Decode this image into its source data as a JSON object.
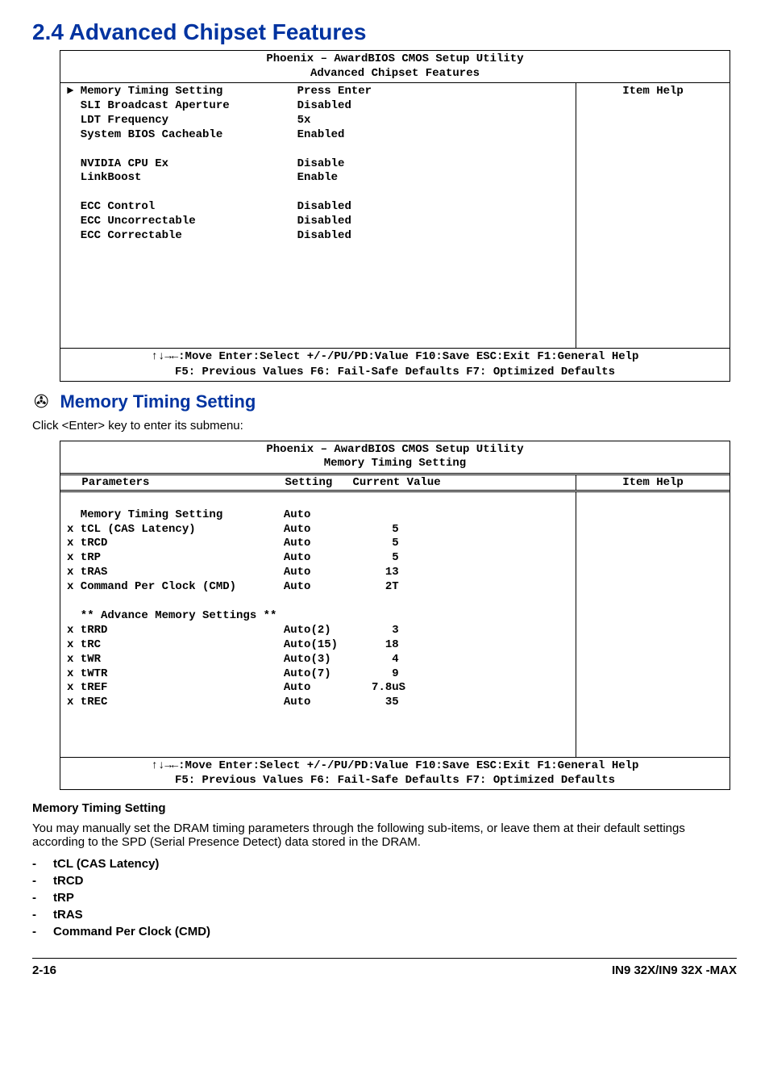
{
  "title": "2.4 Advanced Chipset Features",
  "bios1": {
    "utility": "Phoenix – AwardBIOS CMOS Setup Utility",
    "screen": "Advanced Chipset Features",
    "body": "► Memory Timing Setting           Press Enter\n  SLI Broadcast Aperture          Disabled\n  LDT Frequency                   5x\n  System BIOS Cacheable           Enabled\n\n  NVIDIA CPU Ex                   Disable\n  LinkBoost                       Enable\n\n  ECC Control                     Disabled\n  ECC Uncorrectable               Disabled\n  ECC Correctable                 Disabled\n\n\n\n\n\n\n\n",
    "help_label": "Item Help",
    "footer1": "↑↓→←:Move  Enter:Select  +/-/PU/PD:Value  F10:Save  ESC:Exit  F1:General Help",
    "footer2": "F5: Previous Values   F6: Fail-Safe Defaults   F7: Optimized Defaults"
  },
  "subhead": {
    "icon": "✇",
    "text": "Memory Timing Setting"
  },
  "enter_note": "Click <Enter> key to enter its submenu:",
  "bios2": {
    "utility": "Phoenix – AwardBIOS CMOS Setup Utility",
    "screen": "Memory Timing Setting",
    "th": " Parameters                    Setting   Current Value",
    "help_label": "Item Help",
    "body": "\n  Memory Timing Setting         Auto\nx tCL (CAS Latency)             Auto            5\nx tRCD                          Auto            5\nx tRP                           Auto            5\nx tRAS                          Auto           13\nx Command Per Clock (CMD)       Auto           2T\n\n  ** Advance Memory Settings **\nx tRRD                          Auto(2)         3\nx tRC                           Auto(15)       18\nx tWR                           Auto(3)         4\nx tWTR                          Auto(7)         9\nx tREF                          Auto         7.8uS\nx tREC                          Auto           35\n\n\n\n",
    "footer1": "↑↓→←:Move  Enter:Select  +/-/PU/PD:Value  F10:Save  ESC:Exit  F1:General Help",
    "footer2": "F5: Previous Values   F6: Fail-Safe Defaults   F7: Optimized Defaults"
  },
  "mts_head": "Memory Timing Setting",
  "mts_text": "You may manually set the DRAM timing parameters through the following sub-items, or leave them at their default settings according to the SPD (Serial Presence Detect) data stored in the DRAM.",
  "items": [
    "tCL (CAS Latency)",
    "tRCD",
    "tRP",
    "tRAS",
    "Command Per Clock (CMD)"
  ],
  "footer": {
    "page": "2-16",
    "product": "IN9 32X/IN9 32X -MAX"
  },
  "chart_data": {
    "type": "table",
    "title": "Advanced Chipset Features",
    "columns": [
      "Item",
      "Value"
    ],
    "rows": [
      [
        "Memory Timing Setting",
        "Press Enter"
      ],
      [
        "SLI Broadcast Aperture",
        "Disabled"
      ],
      [
        "LDT Frequency",
        "5x"
      ],
      [
        "System BIOS Cacheable",
        "Enabled"
      ],
      [
        "NVIDIA CPU Ex",
        "Disable"
      ],
      [
        "LinkBoost",
        "Enable"
      ],
      [
        "ECC Control",
        "Disabled"
      ],
      [
        "ECC Uncorrectable",
        "Disabled"
      ],
      [
        "ECC Correctable",
        "Disabled"
      ]
    ],
    "sub_table": {
      "title": "Memory Timing Setting",
      "columns": [
        "Parameters",
        "Setting",
        "Current Value"
      ],
      "rows": [
        [
          "Memory Timing Setting",
          "Auto",
          ""
        ],
        [
          "tCL (CAS Latency)",
          "Auto",
          "5"
        ],
        [
          "tRCD",
          "Auto",
          "5"
        ],
        [
          "tRP",
          "Auto",
          "5"
        ],
        [
          "tRAS",
          "Auto",
          "13"
        ],
        [
          "Command Per Clock (CMD)",
          "Auto",
          "2T"
        ],
        [
          "tRRD",
          "Auto(2)",
          "3"
        ],
        [
          "tRC",
          "Auto(15)",
          "18"
        ],
        [
          "tWR",
          "Auto(3)",
          "4"
        ],
        [
          "tWTR",
          "Auto(7)",
          "9"
        ],
        [
          "tREF",
          "Auto",
          "7.8uS"
        ],
        [
          "tREC",
          "Auto",
          "35"
        ]
      ]
    }
  }
}
